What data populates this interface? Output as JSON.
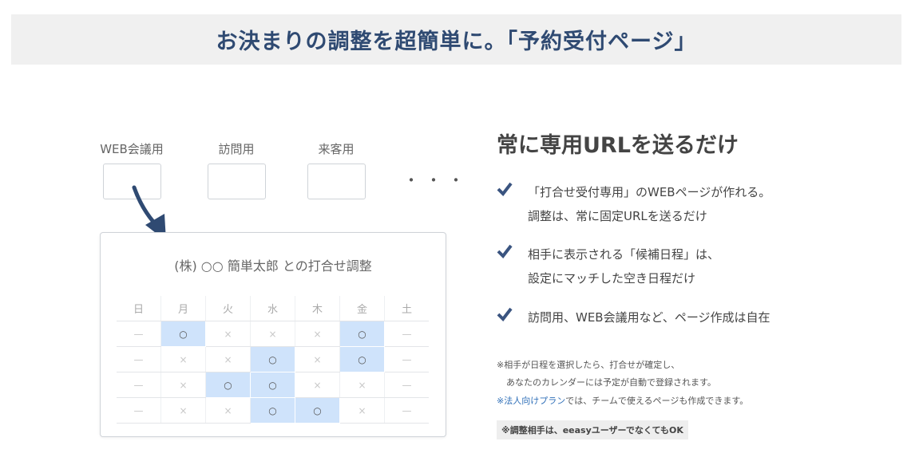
{
  "banner": {
    "title": "お決まりの調整を超簡単に。「予約受付ページ」"
  },
  "page_types": [
    {
      "label": "WEB会議用"
    },
    {
      "label": "訪問用"
    },
    {
      "label": "来客用"
    }
  ],
  "more_indicator": "・・・",
  "card": {
    "title": "(株) ○○ 簡単太郎 との打合せ調整",
    "weekdays": [
      "日",
      "月",
      "火",
      "水",
      "木",
      "金",
      "土"
    ],
    "rows": [
      [
        "—",
        "○",
        "×",
        "×",
        "×",
        "○",
        "—"
      ],
      [
        "—",
        "×",
        "×",
        "○",
        "×",
        "○",
        "—"
      ],
      [
        "—",
        "×",
        "○",
        "○",
        "×",
        "×",
        "—"
      ],
      [
        "—",
        "×",
        "×",
        "○",
        "○",
        "×",
        "—"
      ]
    ],
    "available_symbol": "○",
    "highlight_color": "#cfe3fb"
  },
  "headline": "常に専用URLを送るだけ",
  "features": [
    {
      "line1": "「打合せ受付専用」のWEBページが作れる。",
      "line2": "調整は、常に固定URLを送るだけ"
    },
    {
      "line1": "相手に表示される「候補日程」は、",
      "line2": "設定にマッチした空き日程だけ"
    },
    {
      "line1": "訪問用、WEB会議用など、ページ作成は自在",
      "line2": ""
    }
  ],
  "notes": {
    "line1": "※相手が日程を選択したら、打合せが確定し、",
    "line2": "あなたのカレンダーには予定が自動で登録されます。",
    "plan_prefix": "※",
    "plan_link": "法人向けプラン",
    "plan_suffix": "では、チームで使えるページも作成できます。",
    "badge": "※調整相手は、eeasyユーザーでなくてもOK"
  },
  "colors": {
    "accent": "#2f4a72",
    "check": "#3a5480",
    "link": "#2f6fb8"
  },
  "icons": {
    "check": "checkmark-icon",
    "arrow": "curved-arrow-icon"
  }
}
